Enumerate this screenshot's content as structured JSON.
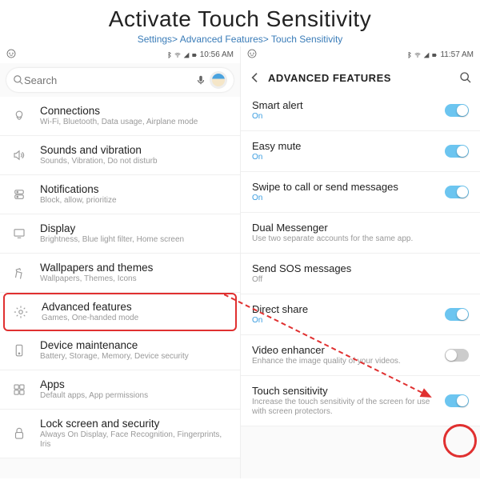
{
  "header": {
    "title": "Activate Touch Sensitivity",
    "breadcrumb": "Settings> Advanced Features> Touch Sensitivity"
  },
  "left": {
    "status_time": "10:56 AM",
    "search_placeholder": "Search",
    "items": [
      {
        "label": "Connections",
        "sub": "Wi-Fi, Bluetooth, Data usage, Airplane mode"
      },
      {
        "label": "Sounds and vibration",
        "sub": "Sounds, Vibration, Do not disturb"
      },
      {
        "label": "Notifications",
        "sub": "Block, allow, prioritize"
      },
      {
        "label": "Display",
        "sub": "Brightness, Blue light filter, Home screen"
      },
      {
        "label": "Wallpapers and themes",
        "sub": "Wallpapers, Themes, Icons"
      },
      {
        "label": "Advanced features",
        "sub": "Games, One-handed mode"
      },
      {
        "label": "Device maintenance",
        "sub": "Battery, Storage, Memory, Device security"
      },
      {
        "label": "Apps",
        "sub": "Default apps, App permissions"
      },
      {
        "label": "Lock screen and security",
        "sub": "Always On Display, Face Recognition, Fingerprints, Iris"
      }
    ]
  },
  "right": {
    "status_time": "11:57 AM",
    "title": "ADVANCED FEATURES",
    "items": [
      {
        "label": "Smart alert",
        "sub": "On",
        "on": true,
        "toggle": true,
        "ton": true
      },
      {
        "label": "Easy mute",
        "sub": "On",
        "on": true,
        "toggle": true,
        "ton": true
      },
      {
        "label": "Swipe to call or send messages",
        "sub": "On",
        "on": true,
        "toggle": true,
        "ton": true
      },
      {
        "label": "Dual Messenger",
        "sub": "Use two separate accounts for the same app.",
        "toggle": false
      },
      {
        "label": "Send SOS messages",
        "sub": "Off",
        "toggle": false
      },
      {
        "label": "Direct share",
        "sub": "On",
        "on": true,
        "toggle": true,
        "ton": true
      },
      {
        "label": "Video enhancer",
        "sub": "Enhance the image quality of your videos.",
        "toggle": true,
        "ton": false
      },
      {
        "label": "Touch sensitivity",
        "sub": "Increase the touch sensitivity of the screen for use with screen protectors.",
        "toggle": true,
        "ton": true
      }
    ]
  }
}
